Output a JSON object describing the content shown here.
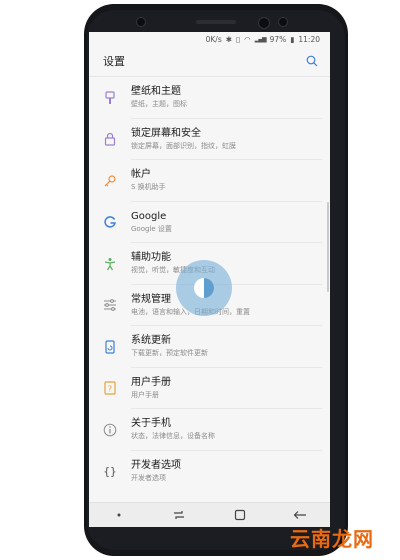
{
  "status_bar": {
    "network_speed": "0K/s",
    "battery": "97%",
    "time": "11:20"
  },
  "header": {
    "title": "设置",
    "search_icon": "search-icon"
  },
  "settings_items": [
    {
      "title": "壁纸和主题",
      "subtitle": "壁纸，主题，图标",
      "icon": "brush-icon",
      "color": "#9b7fd0"
    },
    {
      "title": "锁定屏幕和安全",
      "subtitle": "锁定屏幕，面部识别，指纹，虹膜",
      "icon": "lock-icon",
      "color": "#9b7fd0"
    },
    {
      "title": "帐户",
      "subtitle": "S 换机助手",
      "icon": "key-icon",
      "color": "#f08a3c"
    },
    {
      "title": "Google",
      "subtitle": "Google 设置",
      "icon": "google-icon",
      "color": "#3d7fd6"
    },
    {
      "title": "辅助功能",
      "subtitle": "视觉，听觉，敏捷度和互动",
      "icon": "accessibility-icon",
      "color": "#5bb05a"
    },
    {
      "title": "常规管理",
      "subtitle": "电池，语言和输入，日期和时间，重置",
      "icon": "sliders-icon",
      "color": "#8c8c8c"
    },
    {
      "title": "系统更新",
      "subtitle": "下载更新，预定软件更新",
      "icon": "system-update-icon",
      "color": "#3d7fd6"
    },
    {
      "title": "用户手册",
      "subtitle": "用户手册",
      "icon": "manual-icon",
      "color": "#e0a33a"
    },
    {
      "title": "关于手机",
      "subtitle": "状态，法律信息，设备名称",
      "icon": "info-icon",
      "color": "#8c8c8c"
    },
    {
      "title": "开发者选项",
      "subtitle": "开发者选项",
      "icon": "braces-icon",
      "color": "#555555"
    }
  ],
  "watermark": "云南龙网"
}
